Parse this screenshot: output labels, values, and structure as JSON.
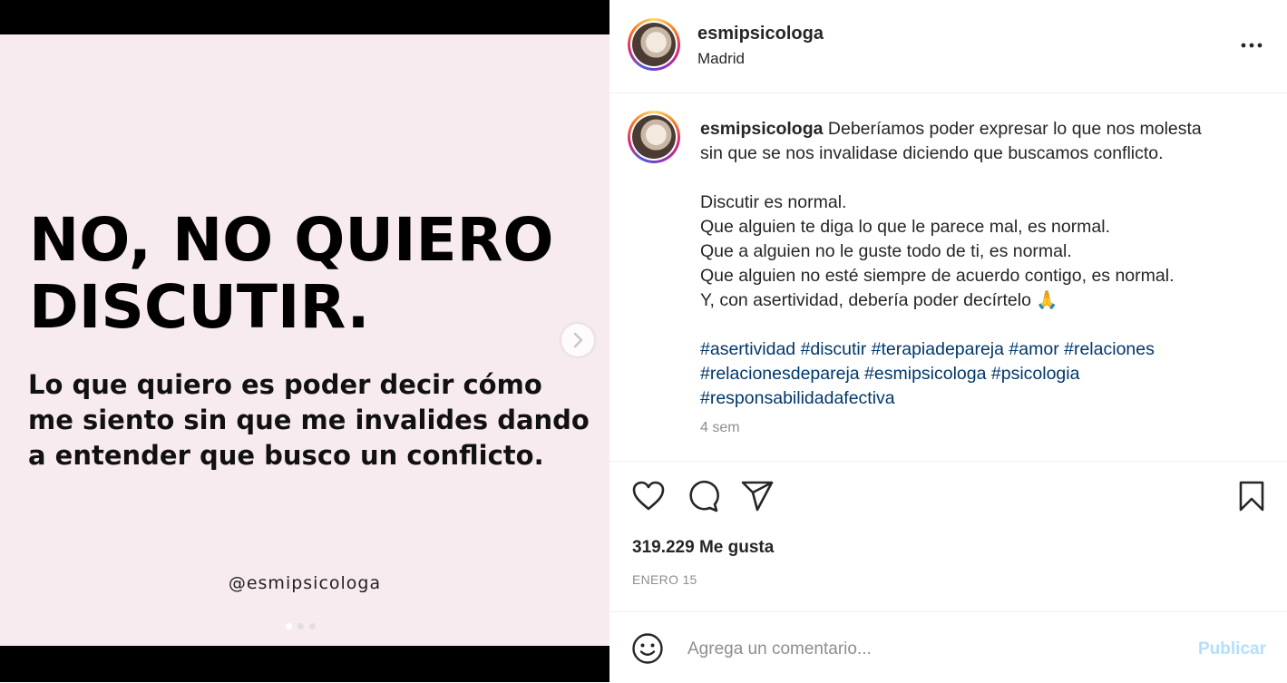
{
  "post": {
    "headline_line1": "NO, NO QUIERO",
    "headline_line2": "DISCUTIR.",
    "subline_line1": "Lo que quiero es poder decir cómo",
    "subline_line2": "me siento sin que me invalides dando",
    "subline_line3": "a entender que busco un conflicto.",
    "watermark_handle": "@esmipsicologa",
    "carousel_dots": 3,
    "active_dot": 1
  },
  "header": {
    "username": "esmipsicologa",
    "location": "Madrid"
  },
  "caption": {
    "username": "esmipsicologa",
    "line1": "Deberíamos poder expresar lo que nos molesta",
    "line2": "sin que se nos invalidase diciendo que buscamos conflicto.",
    "line3": "Discutir es normal.",
    "line4": "Que alguien te diga lo que le parece mal, es normal.",
    "line5": "Que a alguien no le guste todo de ti, es normal.",
    "line6": "Que alguien no esté siempre de acuerdo contigo, es normal.",
    "line7": "Y, con asertividad, debería poder decírtelo 🙏",
    "hashtags": [
      "#asertividad",
      "#discutir",
      "#terapiadepareja",
      "#amor",
      "#relaciones",
      "#relacionesdepareja",
      "#esmipsicologa",
      "#psicologia",
      "#responsabilidadafectiva"
    ],
    "time_ago": "4 sem"
  },
  "stats": {
    "likes": "319.229 Me gusta",
    "date": "ENERO 15"
  },
  "comment": {
    "placeholder": "Agrega un comentario...",
    "publish_label": "Publicar"
  },
  "colors": {
    "slide_background": "#f8ebef",
    "hashtag": "#00376b",
    "publish_disabled": "#b2dffc",
    "muted_text": "#8e8e8e"
  },
  "icons": [
    "chevron-right-icon",
    "more-options-icon",
    "heart-icon",
    "comment-icon",
    "share-icon",
    "bookmark-icon",
    "emoji-icon"
  ]
}
